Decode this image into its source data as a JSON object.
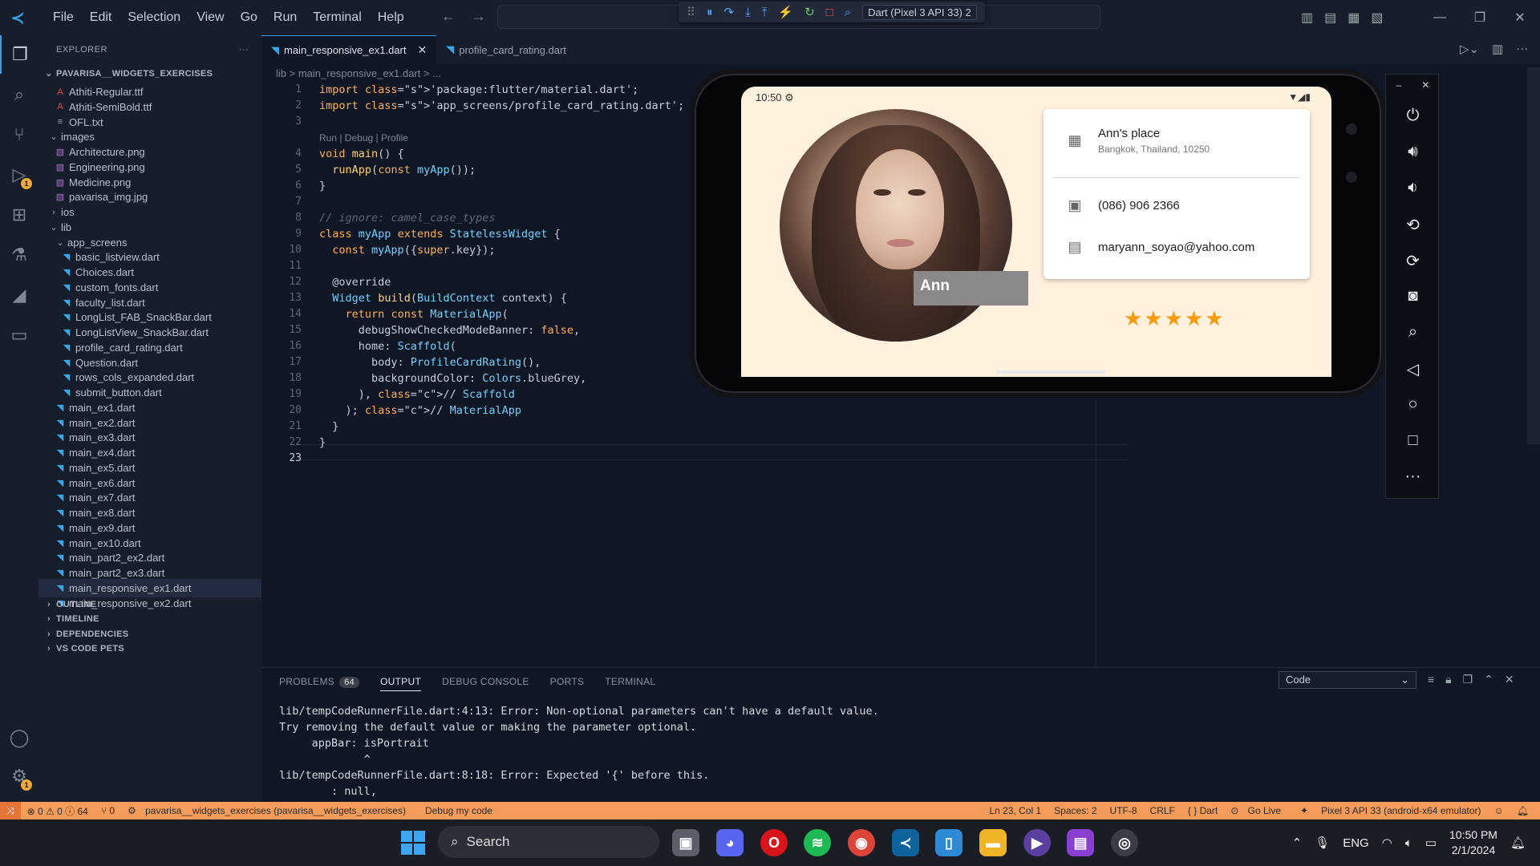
{
  "menu": [
    "File",
    "Edit",
    "Selection",
    "View",
    "Go",
    "Run",
    "Terminal",
    "Help"
  ],
  "debug": {
    "device_select": "Dart (Pixel 3 API 33) 2"
  },
  "explorer": {
    "title": "EXPLORER",
    "project": "PAVARISA__WIDGETS_EXERCISES",
    "items": [
      {
        "label": "Athiti-Regular.ttf",
        "type": "font",
        "indent": 1
      },
      {
        "label": "Athiti-SemiBold.ttf",
        "type": "font",
        "indent": 1
      },
      {
        "label": "OFL.txt",
        "type": "txt",
        "indent": 1
      },
      {
        "label": "images",
        "type": "folder-open",
        "indent": 0
      },
      {
        "label": "Architecture.png",
        "type": "img",
        "indent": 1
      },
      {
        "label": "Engineering.png",
        "type": "img",
        "indent": 1
      },
      {
        "label": "Medicine.png",
        "type": "img",
        "indent": 1
      },
      {
        "label": "pavarisa_img.jpg",
        "type": "img",
        "indent": 1
      },
      {
        "label": "ios",
        "type": "folder",
        "indent": 0
      },
      {
        "label": "lib",
        "type": "folder-open",
        "indent": 0
      },
      {
        "label": "app_screens",
        "type": "folder-open",
        "indent": 1
      },
      {
        "label": "basic_listview.dart",
        "type": "dart",
        "indent": 2
      },
      {
        "label": "Choices.dart",
        "type": "dart",
        "indent": 2
      },
      {
        "label": "custom_fonts.dart",
        "type": "dart",
        "indent": 2
      },
      {
        "label": "faculty_list.dart",
        "type": "dart",
        "indent": 2
      },
      {
        "label": "LongList_FAB_SnackBar.dart",
        "type": "dart",
        "indent": 2
      },
      {
        "label": "LongListView_SnackBar.dart",
        "type": "dart",
        "indent": 2
      },
      {
        "label": "profile_card_rating.dart",
        "type": "dart",
        "indent": 2
      },
      {
        "label": "Question.dart",
        "type": "dart",
        "indent": 2
      },
      {
        "label": "rows_cols_expanded.dart",
        "type": "dart",
        "indent": 2
      },
      {
        "label": "submit_button.dart",
        "type": "dart",
        "indent": 2
      },
      {
        "label": "main_ex1.dart",
        "type": "dart",
        "indent": 1
      },
      {
        "label": "main_ex2.dart",
        "type": "dart",
        "indent": 1
      },
      {
        "label": "main_ex3.dart",
        "type": "dart",
        "indent": 1
      },
      {
        "label": "main_ex4.dart",
        "type": "dart",
        "indent": 1
      },
      {
        "label": "main_ex5.dart",
        "type": "dart",
        "indent": 1
      },
      {
        "label": "main_ex6.dart",
        "type": "dart",
        "indent": 1
      },
      {
        "label": "main_ex7.dart",
        "type": "dart",
        "indent": 1
      },
      {
        "label": "main_ex8.dart",
        "type": "dart",
        "indent": 1
      },
      {
        "label": "main_ex9.dart",
        "type": "dart",
        "indent": 1
      },
      {
        "label": "main_ex10.dart",
        "type": "dart",
        "indent": 1
      },
      {
        "label": "main_part2_ex2.dart",
        "type": "dart",
        "indent": 1
      },
      {
        "label": "main_part2_ex3.dart",
        "type": "dart",
        "indent": 1
      },
      {
        "label": "main_responsive_ex1.dart",
        "type": "dart",
        "indent": 1,
        "selected": true
      },
      {
        "label": "main_responsive_ex2.dart",
        "type": "dart",
        "indent": 1
      }
    ],
    "sections": [
      "OUTLINE",
      "TIMELINE",
      "DEPENDENCIES",
      "VS CODE PETS"
    ]
  },
  "tabs": [
    {
      "label": "main_responsive_ex1.dart",
      "active": true
    },
    {
      "label": "profile_card_rating.dart",
      "active": false
    }
  ],
  "breadcrumb": "lib  >  main_responsive_ex1.dart  >  ...",
  "codelens": "Run | Debug | Profile",
  "code_lines": [
    "import 'package:flutter/material.dart';",
    "import 'app_screens/profile_card_rating.dart';",
    "",
    "void main() {",
    "  runApp(const myApp());",
    "}",
    "",
    "// ignore: camel_case_types",
    "class myApp extends StatelessWidget {",
    "  const myApp({super.key});",
    "",
    "  @override",
    "  Widget build(BuildContext context) {",
    "    return const MaterialApp(",
    "      debugShowCheckedModeBanner: false,",
    "      home: Scaffold(",
    "        body: ProfileCardRating(),",
    "        backgroundColor: Colors.blueGrey,",
    "      ), // Scaffold",
    "    ); // MaterialApp",
    "  }",
    "}",
    ""
  ],
  "phone": {
    "time": "10:50",
    "name": "Ann",
    "place_title": "Ann's place",
    "place_address": "Bangkok, Thailand, 10250",
    "phone": "(086) 906 2366",
    "email": "maryann_soyao@yahoo.com",
    "stars": "★★★★★",
    "rating": 5
  },
  "panel": {
    "tabs": [
      "PROBLEMS",
      "OUTPUT",
      "DEBUG CONSOLE",
      "PORTS",
      "TERMINAL"
    ],
    "problems_count": "64",
    "output_channel": "Code",
    "output_lines": [
      "lib/tempCodeRunnerFile.dart:4:13: Error: Non-optional parameters can't have a default value.",
      "Try removing the default value or making the parameter optional.",
      "     appBar: isPortrait",
      "             ^",
      "lib/tempCodeRunnerFile.dart:8:18: Error: Expected '{' before this.",
      "        : null,",
      "          ^"
    ]
  },
  "statusbar": {
    "errors": "⊗ 0 ⚠ 0 ⓘ 64",
    "ports": "⑂ 0",
    "workspace": "pavarisa__widgets_exercises (pavarisa__widgets_exercises)",
    "debug_label": "Debug my code",
    "cursor": "Ln 23, Col 1",
    "spaces": "Spaces: 2",
    "encoding": "UTF-8",
    "eol": "CRLF",
    "lang": "{ } Dart",
    "golive": "Go Live",
    "device": "Pixel 3 API 33 (android-x64 emulator)"
  },
  "taskbar": {
    "search": "Search",
    "lang": "ENG",
    "time": "10:50 PM",
    "date": "2/1/2024"
  }
}
